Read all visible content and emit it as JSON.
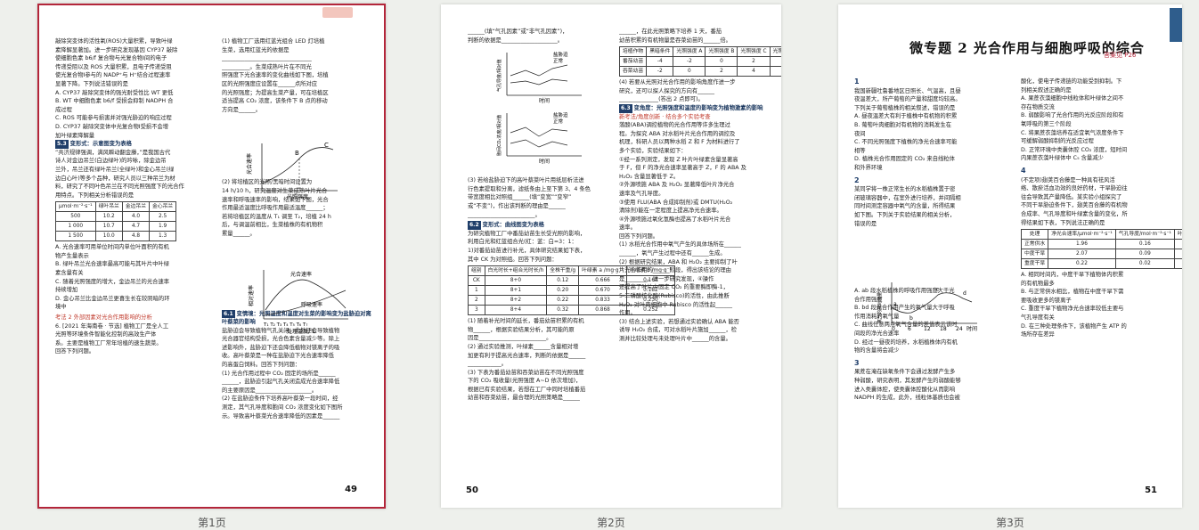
{
  "page1": {
    "number": "49",
    "left": [
      "敲除突变体的活性氧(ROS)大量积累，导致叶绿",
      "素降解显著加。进一步研究发现基因 CYP37 敲除",
      "使细胞色素 b6/f 复合物与光复合物Ⅰ间的电子",
      "传递受阻以及 ROS 大量积累，且电子传递受阻",
      "使光复合物Ⅰ参与的 NADP⁺与 H⁺结合过程速率",
      "显著下降。下列说法错误的是",
      "A. CYP37 敲除突变体的强光耐受性比 WT 更低",
      "B. WT 中细胞色素 b6/f 受损会抑制 NADPH 合",
      "   成过程",
      "C. ROS 可能参与损害并对强光胁迫的响应过程",
      "D. CYP37 敲除突变体中光复合物Ⅰ受损不会增",
      "   加叶绿素降解量"
    ],
    "sec53": "变形式：示意图变为表格",
    "sec53_text": [
      "“共济规律强调，满风瞬动翻金藤，”是我国古代",
      "诗人对金边吊兰(白边绿叶)的吟咏，除金边吊",
      "兰外，吊兰还有绿叶吊兰(全绿叶)和金心吊兰(绿",
      "边白心叶)等多个品种，研究人员以三种吊兰为材",
      "料，研究了不同叶色吊兰在不同光照强度下的光合作",
      "用特点。下列相关分析错误的是"
    ],
    "table_header": [
      "光照强度/",
      "光合速率/μmol·m⁻²·s⁻¹"
    ],
    "table_sub": [
      "μmol·m⁻²·s⁻¹",
      "绿叶吊兰",
      "金边吊兰",
      "金心吊兰"
    ],
    "table_rows": [
      [
        "500",
        "10.2",
        "4.0",
        "2.5"
      ],
      [
        "1 000",
        "10.7",
        "4.7",
        "1.9"
      ],
      [
        "1 500",
        "10.0",
        "4.8",
        "1.3"
      ]
    ],
    "opts": [
      "A. 光合速率可用单位时间内单位叶面积的有机",
      "   物产生量表示",
      "B. 绿叶吊兰光合速率最高可能与其叶片中叶绿",
      "   素含量有关",
      "C. 随着光照强度的增大，金边吊兰的光合速率",
      "   持续增加",
      "D. 金心吊兰比金边吊兰更喜生长在较阴暗的环",
      "   境中"
    ],
    "exam2": "考法 2   外部因素对光合作用影响的分析",
    "q6": [
      "6. [2021 年海南卷 · 节选] 植物工厂是全人工",
      "光照等环境条件智能化控制的高效生产体",
      "系。主要是植物工厂常年培植的速生蔬菜。",
      "回答下列问题。"
    ],
    "right": [
      "(1) 植物工厂选用红蓝光组合 LED 灯培植",
      "生菜，选用红蓝光的依据是",
      "________________________________",
      "__________。生菜成熟叶片在不同光",
      "照强度下光合速率的变化曲线如下图，培植",
      "区的光照强度应设置在______点所对应",
      "的光照强度；为提高生菜产量，可在培植区",
      "适当提高 CO₂ 浓度，该条件下 B 点的移动",
      "方向是______。"
    ],
    "right2": [
      "(2) 将培植区的光照/黑暗时间设置为",
      "14 h/10 h，研究温度对生菜成熟叶片光合",
      "速率和呼吸速率的影响，结果如下图，光合",
      "作用最适温度比呼吸作用最适温度______；",
      "若将培植区的温度从 T₁ 调至 T₂，培植 24 h",
      "后，与调温前相比，生菜植株的有机物积",
      "累量______。"
    ],
    "sec61": "变情境：光照温度和温度对生菜的影响变为盐胁迫对离叶蔡菜的影响",
    "sec61_text": [
      "盐胁迫会导致植物气孔关闭，此外还会导致植物",
      "光合器官结构受损，光合色素含量减少等。除上",
      "述影响外，盐胁迫下还会降低植物对镁离子的吸",
      "收。高叶蔡菜是一种在盐胁迫下光合速率降低",
      "的高蛋白饲料。回答下列问题：",
      "(1) 光合作用过程中 CO₂ 固定的场所是______",
      "______，盐胁迫引起气孔关闭造成光合速率降低",
      "的主要原因是____________________。",
      "(2) 在盐胁迫条件下培养高叶蔡菜一段时间，经",
      "测定，其气孔导度和胞间 CO₂ 浓度变化如下图所",
      "示。导致高叶蔡菜光合速率降低的因素是______"
    ],
    "graph1": {
      "ylabel": "光合速率",
      "xlabel": "光照强度",
      "pointB": "B",
      "pointC": "C"
    },
    "graph2": {
      "curve1": "光合速率",
      "curve2": "呼吸速率",
      "ylabel": "相对速率",
      "xlabel": "处理温度/℃",
      "ticks": "T₁ T₂ T₃ T₄ T₅ T₆ T₇"
    }
  },
  "page2": {
    "number": "50",
    "left": [
      "______(填“气孔因素”或“非气孔因素”)，",
      "判断的依据是____________________。"
    ],
    "legend": [
      "盐胁迫",
      "正常"
    ],
    "g1": {
      "ylabel": "气孔导度/相对值",
      "xlabel": "时间"
    },
    "g2": {
      "ylabel": "胞间CO₂浓度/相对值",
      "xlabel": "时间"
    },
    "left2": [
      "(3) 若给盐胁迫下的高叶蔡菜叶片用纸层析法进",
      "行色素提取和分离，滤纸条由上至下第 3、4 条色",
      "带宽度相比对照组______(填“变宽”“变窄”",
      "或“不变”)，作出该判断的理由是______",
      "________________________。"
    ],
    "sec62": "变形式：曲线图变为表格",
    "sec62_text": [
      "为研究植物工厂中番茄幼苗生长受光照的影响，",
      "利用白光和红蓝组合光(红：蓝：白=3：1：",
      "1)对番茄幼苗进行补光，具体研究结果如下表，",
      "其中 CK 为对照组。回答下列问题："
    ],
    "t2_head": [
      "组别",
      "白光时长+组合光时长/h",
      "全株干重/g",
      "叶绿素 a /mg·g⁻¹",
      "叶绿素 b /mg·g⁻¹"
    ],
    "t2_rows": [
      [
        "CK",
        "8+0",
        "0.12",
        "0.666",
        "0.164"
      ],
      [
        "1",
        "8+1",
        "0.20",
        "0.670",
        "0.182"
      ],
      [
        "2",
        "8+2",
        "0.22",
        "0.833",
        "0.230"
      ],
      [
        "3",
        "8+4",
        "0.32",
        "0.868",
        "0.252"
      ]
    ],
    "left3": [
      "(1) 随着补光时间的延长，番茄幼苗积累的有机",
      "物______，根据实验结果分析，其可能的原",
      "因是________________________。",
      "(2) 通过实验推测，叶绿素______含量相对增",
      "加更有利于提高光合速率，判断的依据是______",
      "____________。",
      "(3) 下表为番茄幼苗和吞菜幼苗在不同光照强度",
      "下的 CO₂ 吸收量(光照强度 A~D 依次增加)，",
      "根据已有实验结果，若想在工厂中同时培植番茄",
      "幼苗和吞菜幼苗，最合理的光照策略是______"
    ],
    "right": [
      "______，在此光照策略下培养 1 天，番茄",
      "幼苗积累的有机物量是吞菜幼苗的______倍。"
    ],
    "t3_head": [
      "培植作物",
      "不同光照强度下 CO₂ 吸收量/相对值"
    ],
    "t3_sub": [
      "黑暗条件",
      "光照强度 A",
      "光照强度 B",
      "光照强度 C",
      "光照强度 D"
    ],
    "t3_rows": [
      [
        "番茄幼苗",
        "-4",
        "-2",
        "0",
        "2",
        "8"
      ],
      [
        "吞菜幼苗",
        "-2",
        "0",
        "2",
        "4",
        "4"
      ]
    ],
    "right2": [
      "(4) 若要从光照对光合作用的影响角度作进一步",
      "研究，还可以探人探究的方向有______",
      "______________(答出 2 点即可)。"
    ],
    "sec63": "变角度：光照强度和温度的影响变为植物激素的影响",
    "sec63_red": "新考法/角度创新 · 结合多个实验考查",
    "sec63_text": [
      "落酸(ABA)调控植物的光合作用等许多生理过",
      "程。为探究 ABA 对水稻叶片光合作用的调控及",
      "机理，科研人员以两种水稻 Z 和 F 为材料进行了",
      "多个实验，实验结果如下：",
      "①经一系列测定，发现 Z 叶片叶绿素含量显著高",
      "于 F，但 F 的净光合速率显著高于 Z，F 的 ABA 及",
      "H₂O₂ 含量显著低于 Z。",
      "②外源喷施 ABA 及 H₂O₂ 显著降低叶片净光合",
      "速率及气孔导度。",
      "③使用 FLU(ABA 合成抑制剂)或 DMTU(H₂O₂",
      "清除剂)能在一定程度上提高净光合速率。",
      "④外源喷施过氧化氢酶也提高了水稻叶片光合",
      "速率。",
      "回答下列问题。",
      "(1) 水稻光合作用中氧气产生的具体场所在______",
      "______，氧气产生过程中还有______生成。",
      "(2) 根据研究结果，ABA 和 H₂O₂ 主要抑制了叶",
      "片光合作用的______阶段，得出该结论的理由",
      "是________。进一步研究发现，④操作",
      "还提高了叶片中固定 CO₂ 的重要酶即酶-1，",
      "5-二磷酸核化酶(Rubisco)的活性，由此推断",
      "H₂O₂ 对叶肉细胞中 Rubisco 的活性起______",
      "作用。",
      "(3) 结合上述实验，若想通过实验确认 ABA 能否",
      "诱导 H₂O₂ 合成，可对水稻叶片施加______，检",
      "测并比较处理与未处理叶片中______的含量。"
    ]
  },
  "page3": {
    "number": "51",
    "title": "微专题 2   光合作用与细胞呼吸的综合",
    "answer_ref": "答案见 P26",
    "q1": [
      "我国新疆吐鲁番地区日照长、气温高，且昼",
      "夜温差大，所产葡萄的产量和甜度均较高。",
      "下列关于葡萄植株的相关叙述，错误的是",
      "A. 昼夜温差大有利于植株中有机物的积累",
      "B. 葡萄叶肉细胞对有机物的消耗发生在",
      "   夜间",
      "C. 不同光照强度下植株的净光合速率可能",
      "   相等",
      "D. 植株光合作用固定的 CO₂ 来自线粒体",
      "   和外界环境"
    ],
    "q2": [
      "某同学将一株正常生长的水稻植株置于密",
      "闭玻璃容器中，在室外进行培养，并间隔相",
      "同时间测定容器中氧气的含量，所得结果",
      "如下图。下列关于实验结果的相关分析，",
      "错误的是"
    ],
    "q2_graph": {
      "ylabel": "氧气的相对含量",
      "xlabel": "时间",
      "ticks": [
        "0",
        "6",
        "12",
        "18",
        "24"
      ],
      "points": [
        "a",
        "b",
        "c",
        "d"
      ]
    },
    "q2_opts": [
      "A. ab 段水稻植株的呼吸作用强度大于光",
      "   合作用强度",
      "B. bd 段光合作用产生的氧气量大于呼吸",
      "   作用消耗的氧气量",
      "C. 曲线任意两点氧气含量的差值表示该时",
      "   间段的净光合速率",
      "D. 经过一昼夜的培养，水稻植株体内有机",
      "   物的含量将会减少"
    ],
    "q3": [
      "果蔗在淹在缺氧条件下会通过发酵产生多",
      "种弱酸，研究表明，其发酵产生的弱酸能够",
      "进入类囊体腔，使类囊体腔酸化从而影响",
      "NADPH 的生成，此外，线粒体基质也会被"
    ],
    "right": [
      "酸化，使电子传递链的功能受到抑制。下",
      "列相关叙述正确的是",
      "A. 果蔗衣藻细胞中线粒体和叶绿体之间不",
      "   存在物质交流",
      "B. 弱酸影响了光合作用的光反应阶段和有",
      "   氧呼吸的第三个阶段",
      "C. 将果蔗衣藻培养在适宜氧气浓度条件下",
      "   可缓解弱酸抑制的光反应过程",
      "D. 正常环境中类囊体腔 CO₂ 浓度，短时间",
      "   内果蔗衣藻叶绿体中 C₅ 含量减少"
    ],
    "q4": [
      "(不定项)翅荚百合藤是一种具有祛风活",
      "络、散瘀活血功效的良好药材，干旱胁迫往",
      "往会导致其产量降低。某实验小组探究了",
      "不同干旱胁迫条件下，翅荚百合藤的有机物",
      "合成率、气孔导度和叶绿素含量的变化，所",
      "得结果如下表，下列说法正确的是"
    ],
    "t4_head": [
      "处理",
      "净光合速率/μmol·m⁻²·s⁻¹",
      "气孔导度/mol·m⁻²·s⁻¹",
      "叶绿素总量/mg·g⁻¹"
    ],
    "t4_rows": [
      [
        "正常供水",
        "1.96",
        "0.16",
        "0.795"
      ],
      [
        "中度干旱",
        "2.07",
        "0.09",
        "1.066"
      ],
      [
        "重度干旱",
        "0.22",
        "0.02",
        "0.935"
      ]
    ],
    "q4_opts": [
      "A. 相同时间内，中度干旱下植物体内积累",
      "   的有机物最多",
      "B. 与正常供水相比，植物在中度干旱下需",
      "   要吸收更多的镁离子",
      "C. 重度干旱下植物净光合速率较低主要与",
      "   气孔导度有关",
      "D. 在三种处理条件下，该植物产生 ATP 的",
      "   场所存在差异"
    ]
  },
  "captions": [
    "第1页",
    "第2页",
    "第3页"
  ]
}
